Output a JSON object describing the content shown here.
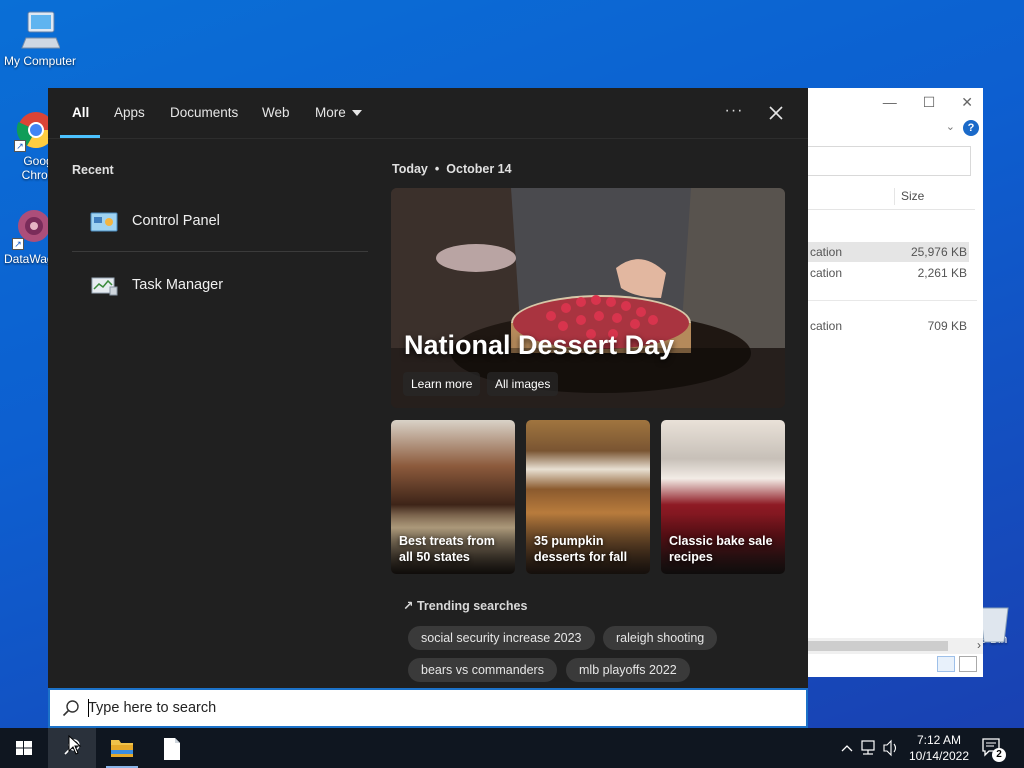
{
  "desktop": {
    "icons": [
      {
        "label": "My Computer",
        "icon": "computer-icon"
      },
      {
        "label": "Goog Chron",
        "icon": "chrome-icon"
      },
      {
        "label": "DataWag",
        "icon": "datawag-icon"
      },
      {
        "label": "e Bin",
        "icon": "recycle-bin-icon"
      }
    ]
  },
  "explorer": {
    "column_header": "Size",
    "rows": [
      {
        "type": "cation",
        "size": "25,976 KB",
        "selected": true
      },
      {
        "type": "cation",
        "size": "2,261 KB",
        "selected": false
      },
      {
        "type": "cation",
        "size": "709 KB",
        "selected": false
      }
    ]
  },
  "search": {
    "tabs": [
      {
        "label": "All",
        "active": true
      },
      {
        "label": "Apps"
      },
      {
        "label": "Documents"
      },
      {
        "label": "Web"
      },
      {
        "label": "More"
      }
    ],
    "more_options_label": "···",
    "close_label": "✕",
    "recent": {
      "heading": "Recent",
      "items": [
        {
          "label": "Control Panel",
          "icon": "control-panel-icon"
        },
        {
          "label": "Task Manager",
          "icon": "task-manager-icon"
        }
      ]
    },
    "today": {
      "label": "Today",
      "date": "October 14",
      "hero": {
        "title": "National Dessert Day",
        "learn_more": "Learn more",
        "all_images": "All images"
      },
      "cards": [
        {
          "label": "Best treats from all 50 states"
        },
        {
          "label": "35 pumpkin desserts for fall"
        },
        {
          "label": "Classic bake sale recipes"
        }
      ]
    },
    "trending": {
      "heading": "Trending searches",
      "items": [
        "social security increase 2023",
        "raleigh shooting",
        "bears vs commanders",
        "mlb playoffs 2022"
      ]
    },
    "input": {
      "placeholder": "Type here to search",
      "value": ""
    }
  },
  "taskbar": {
    "time": "7:12 AM",
    "date": "10/14/2022",
    "notification_count": "2"
  },
  "colors": {
    "accent": "#4cc2ff",
    "panel_bg": "#202020",
    "desktop_bg": "#0d5fd0",
    "search_border": "#1c72c9"
  }
}
